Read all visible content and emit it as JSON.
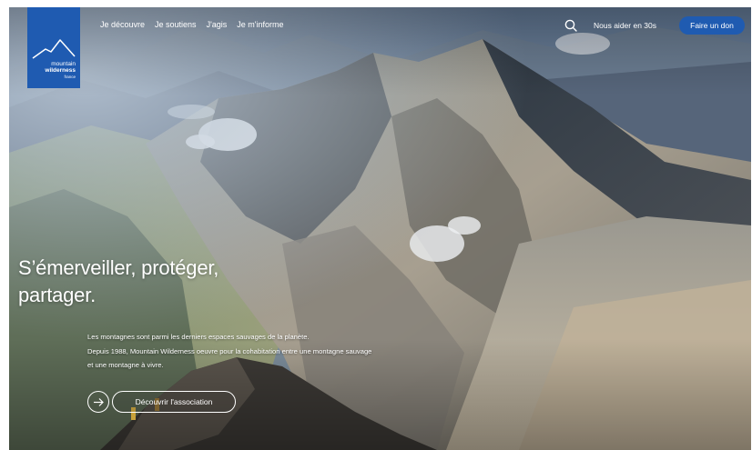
{
  "header": {
    "logo": {
      "line1": "mountain",
      "line2": "wilderness",
      "line3": "france"
    },
    "nav": [
      {
        "label": "Je découvre"
      },
      {
        "label": "Je soutiens"
      },
      {
        "label": "J'agis"
      },
      {
        "label": "Je m'informe"
      }
    ],
    "help_label": "Nous aider en 30s",
    "donate_label": "Faire un don"
  },
  "hero": {
    "headline_line1": "S’émerveiller, protéger,",
    "headline_line2": "partager.",
    "intro_lines": [
      "Les montagnes sont parmi les derniers espaces sauvages de la planète.",
      "Depuis 1988, Mountain Wilderness oeuvre pour la cohabitation entre une montagne sauvage",
      "et une montagne à vivre."
    ],
    "cta_label": "Découvrir l'association"
  },
  "colors": {
    "brand_blue": "#1f5bb1",
    "text_on_image": "#ffffff"
  },
  "icons": {
    "search": "search-icon",
    "arrow": "arrow-right-icon"
  }
}
